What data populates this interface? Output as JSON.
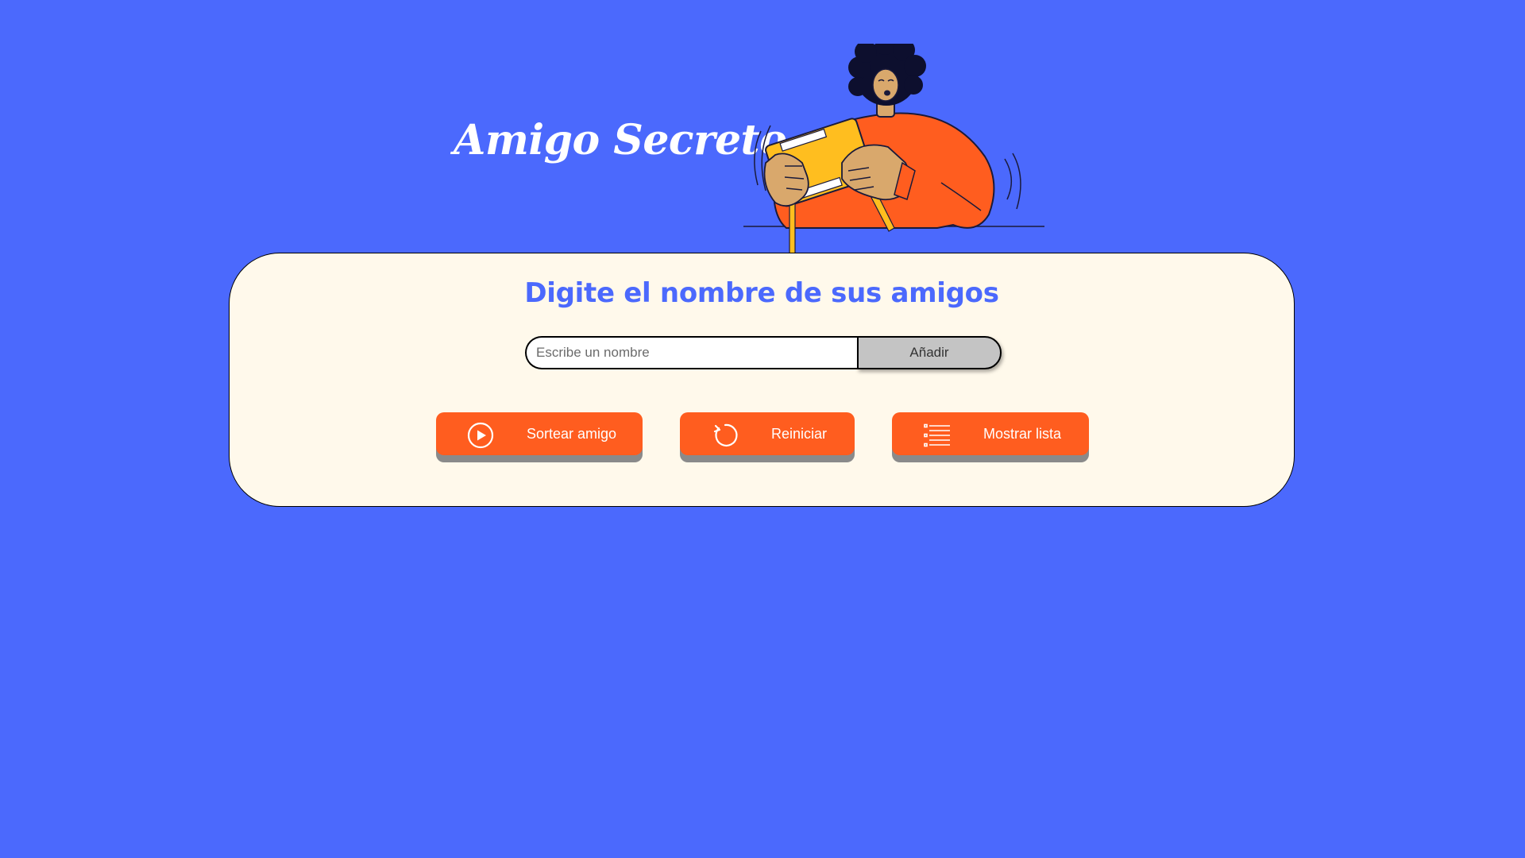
{
  "header": {
    "title": "Amigo Secreto",
    "illustration_name": "person-holding-gift-illustration"
  },
  "main": {
    "heading": "Digite el nombre de sus amigos",
    "name_input": {
      "value": "",
      "placeholder": "Escribe un nombre"
    },
    "add_button_label": "Añadir",
    "actions": [
      {
        "label": "Sortear amigo",
        "icon": "play-circle-icon"
      },
      {
        "label": "Reiniciar",
        "icon": "refresh-icon"
      },
      {
        "label": "Mostrar lista",
        "icon": "list-icon"
      }
    ]
  },
  "colors": {
    "background": "#4B69FD",
    "card": "#FFF9EB",
    "accent": "#FF5D1F",
    "heading": "#4B69FD",
    "button_shadow": "#8A8A8A",
    "add_button": "#C4C4C4"
  }
}
